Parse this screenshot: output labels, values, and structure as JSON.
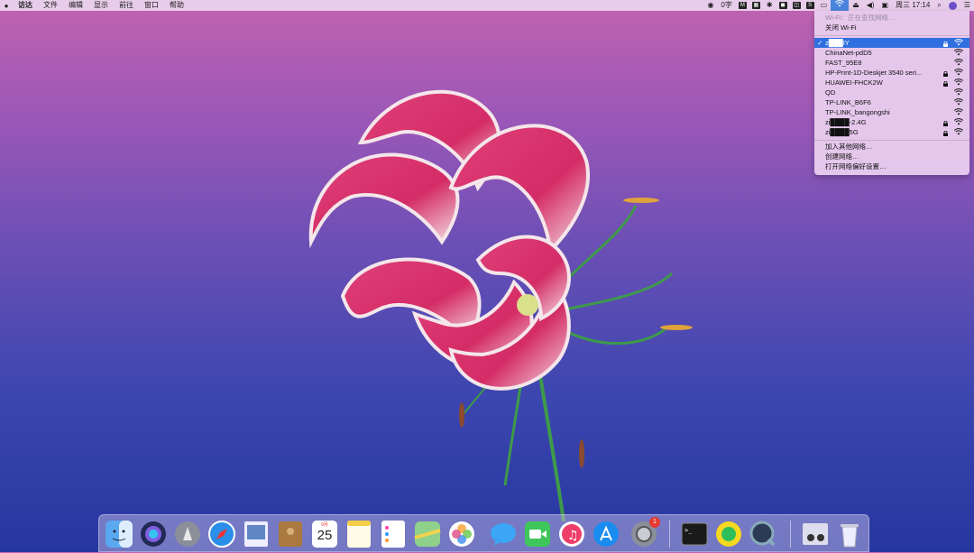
{
  "menubar": {
    "apple_icon": "apple-icon",
    "app_name": "访达",
    "items": [
      "文件",
      "编辑",
      "显示",
      "前往",
      "窗口",
      "帮助"
    ],
    "status_items": {
      "ime": "0字",
      "clock": "周三 17:14"
    }
  },
  "wifi_menu": {
    "status": "Wi-Fi：正在查找网络…",
    "toggle": "关闭 Wi-Fi",
    "networks": [
      {
        "name": "z███IY",
        "locked": true,
        "selected": true
      },
      {
        "name": "ChinaNet-pdD5",
        "locked": false,
        "selected": false
      },
      {
        "name": "FAST_95E8",
        "locked": false,
        "selected": false
      },
      {
        "name": "HP-Print-1D-Deskjet 3540 seri...",
        "locked": true,
        "selected": false
      },
      {
        "name": "HUAWEI-FHCK2W",
        "locked": true,
        "selected": false
      },
      {
        "name": "QD",
        "locked": false,
        "selected": false
      },
      {
        "name": "TP-LINK_B6F6",
        "locked": false,
        "selected": false
      },
      {
        "name": "TP-LINK_bangongshi",
        "locked": false,
        "selected": false
      },
      {
        "name": "zi████-2.4G",
        "locked": true,
        "selected": false
      },
      {
        "name": "zi████5G",
        "locked": true,
        "selected": false
      }
    ],
    "actions": [
      "加入其他网络…",
      "创建网络…",
      "打开网络偏好设置…"
    ]
  },
  "dock": {
    "calendar_month": "9月",
    "calendar_day": "25",
    "system_prefs_badge": "1",
    "apps": [
      "finder-icon",
      "siri-icon",
      "launchpad-icon",
      "safari-icon",
      "preview-icon",
      "contacts-icon",
      "calendar-icon",
      "notes-icon",
      "reminders-icon",
      "maps-icon",
      "photos-icon",
      "messages-icon",
      "facetime-icon",
      "music-icon",
      "app-store-icon",
      "system-preferences-icon",
      "terminal-icon",
      "qq-music-icon",
      "quicktime-icon",
      "image-capture-icon",
      "trash-icon"
    ]
  },
  "colors": {
    "menu_highlight": "#2f6fe0",
    "badge": "#e53b33"
  }
}
